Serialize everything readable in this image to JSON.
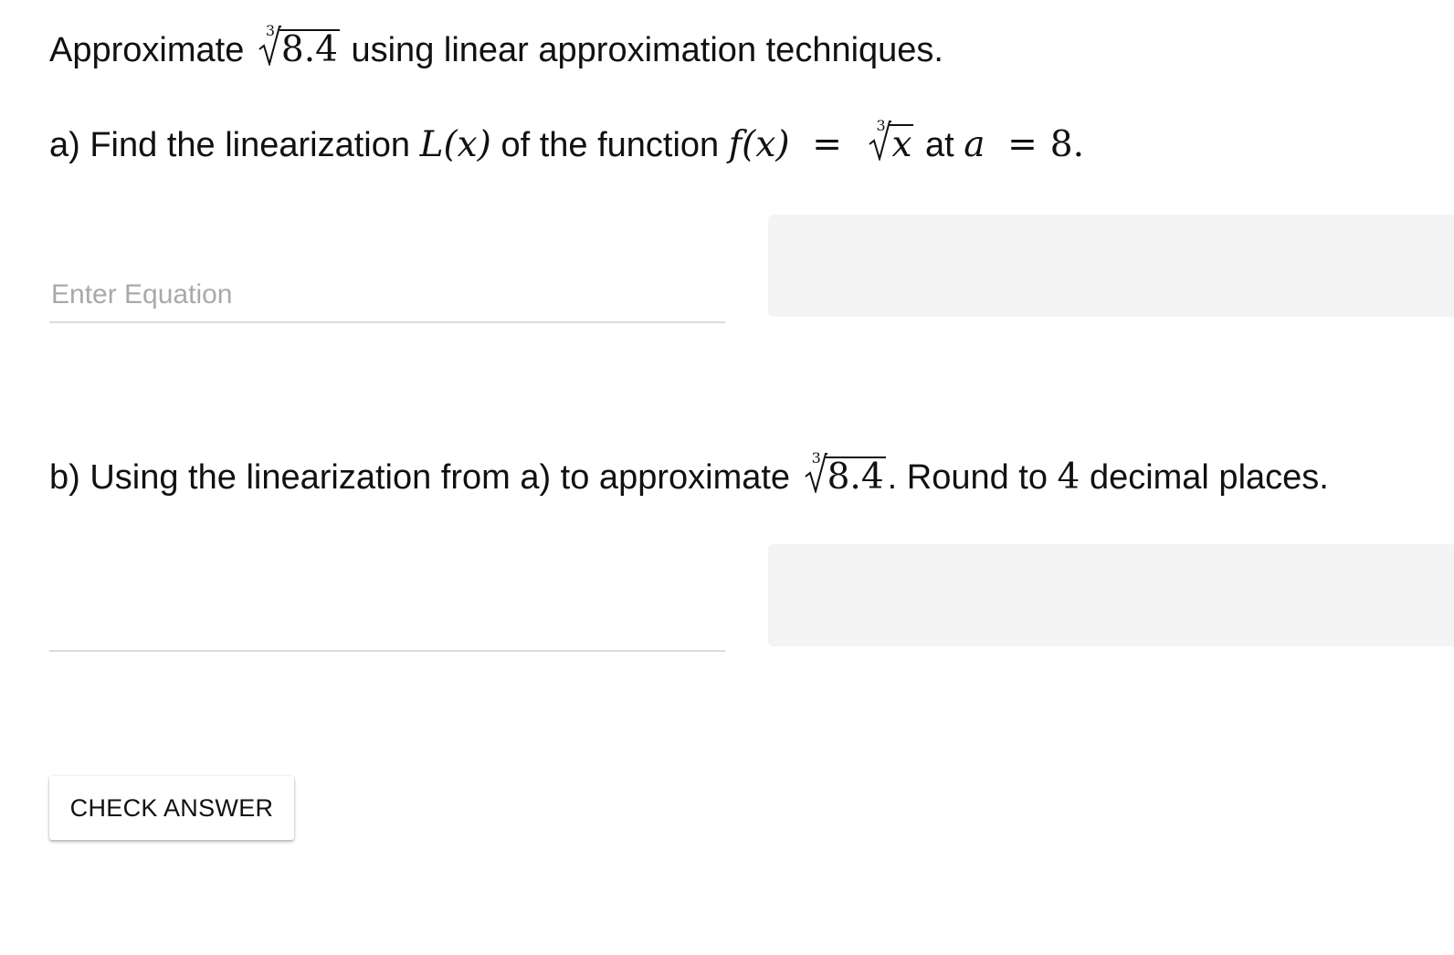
{
  "intro": {
    "prefix": "Approximate",
    "root_index": "3",
    "radicand": "8.4",
    "suffix": "using linear approximation techniques."
  },
  "part_a": {
    "prefix": "a) Find the linearization",
    "L_of_x": "L(x)",
    "middle": "of the function",
    "f_of_x": "f(x)",
    "equals": "=",
    "root_index": "3",
    "radicand": "x",
    "at_text": "at",
    "a_var": "a",
    "a_equals": "=",
    "a_value": "8."
  },
  "part_b": {
    "prefix": "b) Using the linearization from a) to approximate",
    "root_index": "3",
    "radicand": "8.4",
    "round_text": ". Round to",
    "digits": "4",
    "suffix": "decimal places."
  },
  "inputs": {
    "a": {
      "placeholder": "Enter Equation",
      "value": ""
    },
    "b": {
      "placeholder": "",
      "value": ""
    }
  },
  "buttons": {
    "check_answer": "CHECK ANSWER"
  }
}
